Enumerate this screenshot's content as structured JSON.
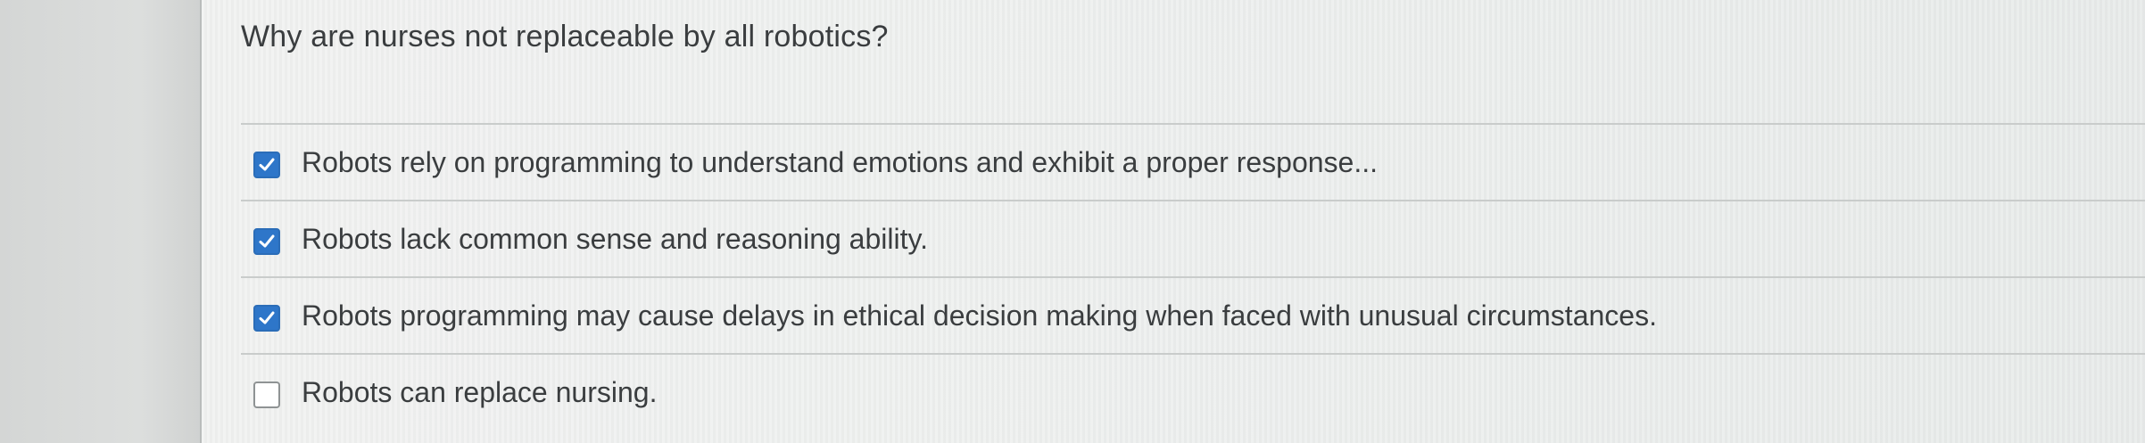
{
  "question": {
    "text": "Why are nurses not replaceable by all robotics?"
  },
  "answers": [
    {
      "label": "Robots rely on programming to understand emotions and exhibit a proper response...",
      "checked": true
    },
    {
      "label": "Robots lack common sense and reasoning ability.",
      "checked": true
    },
    {
      "label": "Robots programming may cause delays in ethical decision making when faced with unusual circumstances.",
      "checked": true
    },
    {
      "label": "Robots can replace nursing.",
      "checked": false
    }
  ],
  "colors": {
    "checkbox_checked": "#2e76c9",
    "text": "#3a3d3f"
  },
  "icons": {
    "checked": "checkmark-icon"
  }
}
